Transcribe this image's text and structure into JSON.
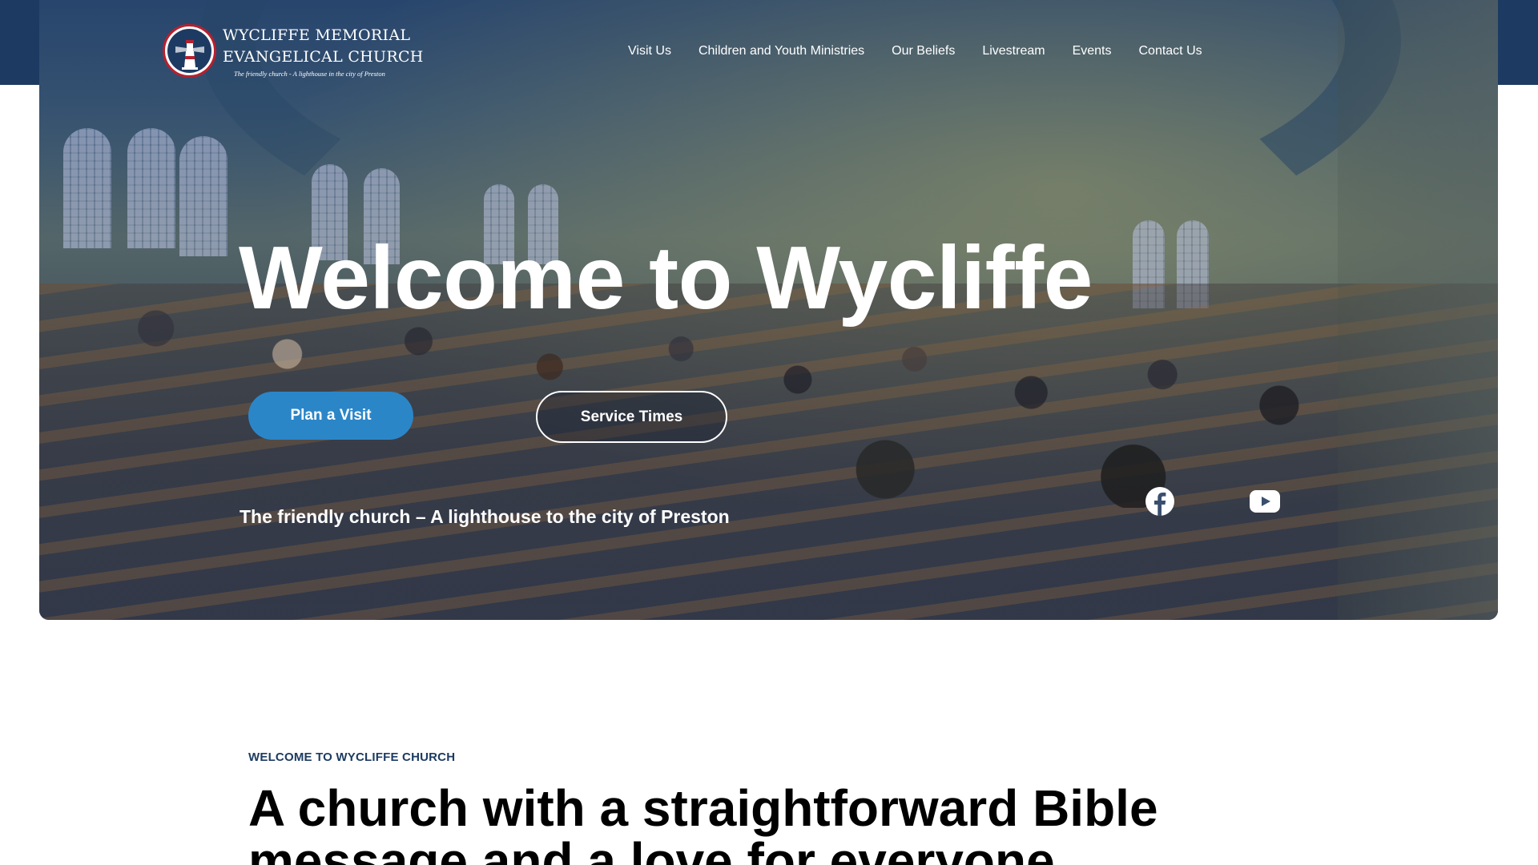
{
  "site": {
    "logo": {
      "name_line1": "WYCLIFFE MEMORIAL",
      "name_line2": "EVANGELICAL CHURCH",
      "tagline": "The friendly church - A lighthouse in the city of Preston"
    },
    "nav": [
      {
        "label": "Visit Us"
      },
      {
        "label": "Children and Youth Ministries"
      },
      {
        "label": "Our Beliefs"
      },
      {
        "label": "Livestream"
      },
      {
        "label": "Events"
      },
      {
        "label": "Contact Us"
      }
    ],
    "colors": {
      "header_bg": "#1d3b62",
      "primary_button": "#2b86c8",
      "kicker": "#1d3b62"
    }
  },
  "hero": {
    "title": "Welcome to Wycliffe",
    "primary_button": "Plan a Visit",
    "secondary_button": "Service Times",
    "tagline": "The friendly church – A lighthouse to the city of Preston",
    "social": [
      {
        "icon": "facebook-icon"
      },
      {
        "icon": "youtube-icon"
      }
    ]
  },
  "intro": {
    "kicker": "WELCOME TO WYCLIFFE CHURCH",
    "heading": "A church with a straightforward Bible message and a love for everyone"
  }
}
